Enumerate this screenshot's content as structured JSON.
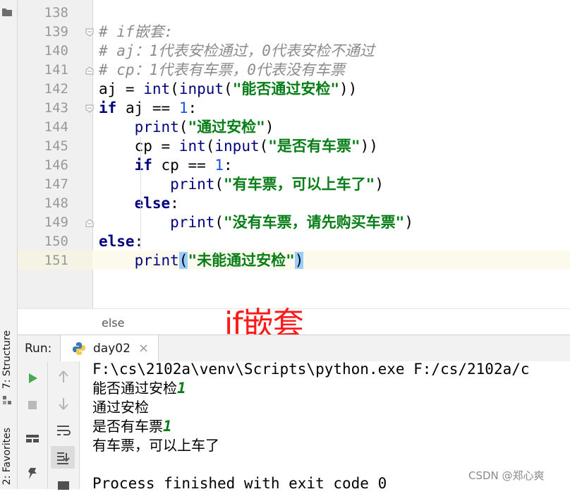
{
  "side_tabs": {
    "structure": "7: Structure",
    "favorites": "2: Favorites"
  },
  "editor": {
    "lines": [
      {
        "num": "138",
        "tokens": []
      },
      {
        "num": "139",
        "tokens": [
          {
            "t": "cmt",
            "v": "# if嵌套:"
          }
        ]
      },
      {
        "num": "140",
        "tokens": [
          {
            "t": "cmt",
            "v": "# aj：1代表安检通过，0代表安检不通过"
          }
        ]
      },
      {
        "num": "141",
        "tokens": [
          {
            "t": "cmt",
            "v": "# cp：1代表有车票，0代表没有车票"
          }
        ]
      },
      {
        "num": "142",
        "tokens": [
          {
            "t": "plain",
            "v": "aj = "
          },
          {
            "t": "fn",
            "v": "int"
          },
          {
            "t": "plain",
            "v": "("
          },
          {
            "t": "fn",
            "v": "input"
          },
          {
            "t": "plain",
            "v": "("
          },
          {
            "t": "str",
            "v": "\"能否通过安检\""
          },
          {
            "t": "plain",
            "v": "))"
          }
        ]
      },
      {
        "num": "143",
        "tokens": [
          {
            "t": "kw",
            "v": "if"
          },
          {
            "t": "plain",
            "v": " aj == "
          },
          {
            "t": "num",
            "v": "1"
          },
          {
            "t": "plain",
            "v": ":"
          }
        ]
      },
      {
        "num": "144",
        "tokens": [
          {
            "t": "plain",
            "v": "    "
          },
          {
            "t": "fn",
            "v": "print"
          },
          {
            "t": "plain",
            "v": "("
          },
          {
            "t": "str",
            "v": "\"通过安检\""
          },
          {
            "t": "plain",
            "v": ")"
          }
        ]
      },
      {
        "num": "145",
        "tokens": [
          {
            "t": "plain",
            "v": "    cp = "
          },
          {
            "t": "fn",
            "v": "int"
          },
          {
            "t": "plain",
            "v": "("
          },
          {
            "t": "fn",
            "v": "input"
          },
          {
            "t": "plain",
            "v": "("
          },
          {
            "t": "str",
            "v": "\"是否有车票\""
          },
          {
            "t": "plain",
            "v": "))"
          }
        ]
      },
      {
        "num": "146",
        "tokens": [
          {
            "t": "plain",
            "v": "    "
          },
          {
            "t": "kw",
            "v": "if"
          },
          {
            "t": "plain",
            "v": " cp == "
          },
          {
            "t": "num",
            "v": "1"
          },
          {
            "t": "plain",
            "v": ":"
          }
        ]
      },
      {
        "num": "147",
        "tokens": [
          {
            "t": "plain",
            "v": "        "
          },
          {
            "t": "fn",
            "v": "print"
          },
          {
            "t": "plain",
            "v": "("
          },
          {
            "t": "str",
            "v": "\"有车票，可以上车了\""
          },
          {
            "t": "plain",
            "v": ")"
          }
        ]
      },
      {
        "num": "148",
        "tokens": [
          {
            "t": "plain",
            "v": "    "
          },
          {
            "t": "kw",
            "v": "else"
          },
          {
            "t": "plain",
            "v": ":"
          }
        ]
      },
      {
        "num": "149",
        "tokens": [
          {
            "t": "plain",
            "v": "        "
          },
          {
            "t": "fn",
            "v": "print"
          },
          {
            "t": "plain",
            "v": "("
          },
          {
            "t": "str",
            "v": "\"没有车票，请先购买车票\""
          },
          {
            "t": "plain",
            "v": ")"
          }
        ]
      },
      {
        "num": "150",
        "tokens": [
          {
            "t": "kw",
            "v": "else"
          },
          {
            "t": "plain",
            "v": ":"
          }
        ]
      },
      {
        "num": "151",
        "tokens": [
          {
            "t": "plain",
            "v": "    "
          },
          {
            "t": "fn",
            "v": "print"
          },
          {
            "t": "hl",
            "v": "("
          },
          {
            "t": "str",
            "v": "\"未能通过安检\""
          },
          {
            "t": "hl",
            "v": ")"
          }
        ]
      }
    ]
  },
  "breadcrumb": "else",
  "annotation": "if嵌套",
  "run": {
    "label": "Run:",
    "tab_label": "day02",
    "tab_close": "×",
    "console": [
      {
        "text": "F:\\cs\\2102a\\venv\\Scripts\\python.exe F:/cs/2102a/c",
        "input": ""
      },
      {
        "text": "能否通过安检",
        "input": "1"
      },
      {
        "text": "通过安检",
        "input": ""
      },
      {
        "text": "是否有车票",
        "input": "1"
      },
      {
        "text": "有车票，可以上车了",
        "input": ""
      },
      {
        "text": "",
        "input": ""
      },
      {
        "text": "Process finished with exit code 0",
        "input": ""
      }
    ]
  },
  "watermark": "CSDN @郑心爽",
  "colors": {
    "keyword": "#000080",
    "string": "#067d17",
    "number": "#1750eb",
    "comment": "#8c8c8c",
    "annotation": "#ff1a1a"
  }
}
